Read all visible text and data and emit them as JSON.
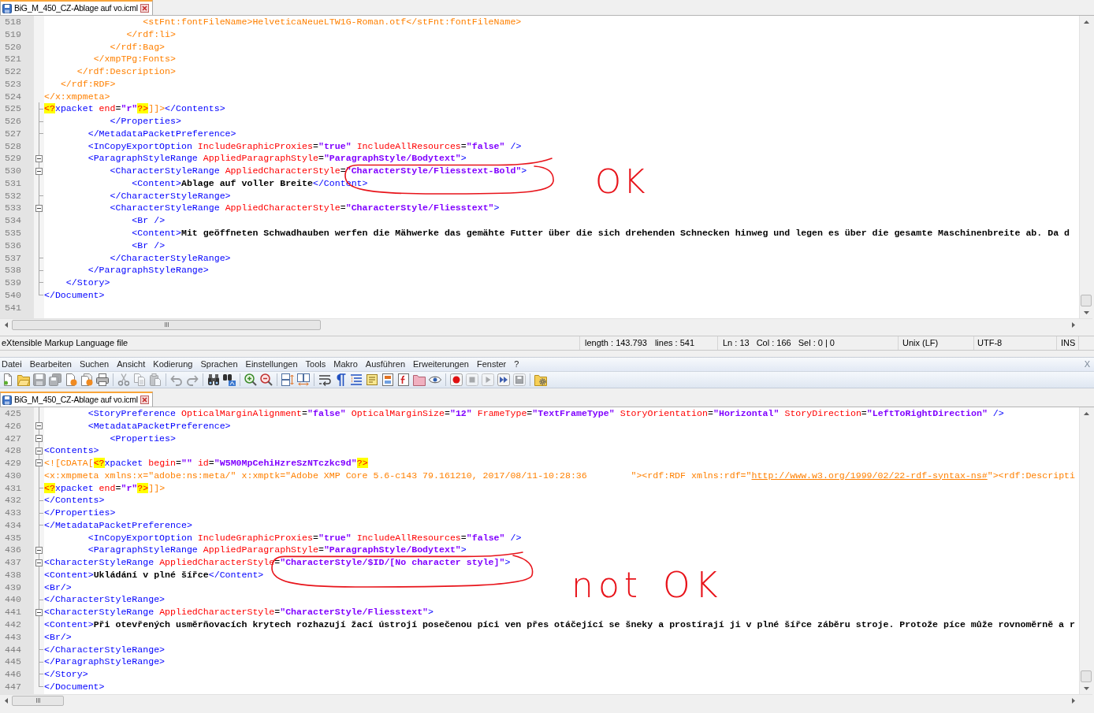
{
  "top_window": {
    "tabs": [
      {
        "label": "BiG_M_450_CZ-Ablage auf vo.icml",
        "selected": true
      }
    ],
    "editor": {
      "starts_in_cdata": true,
      "lines": [
        {
          "number": "518",
          "kind": "plain",
          "text": "                  <stFnt:fontFileName>HelveticaNeueLTW1G-Roman.otf</stFnt:fontFileName>"
        },
        {
          "number": "519",
          "kind": "plain",
          "text": "               </rdf:li>"
        },
        {
          "number": "520",
          "kind": "plain",
          "text": "            </rdf:Bag>"
        },
        {
          "number": "521",
          "kind": "plain",
          "text": "         </xmpTPg:Fonts>"
        },
        {
          "number": "522",
          "kind": "plain",
          "text": "      </rdf:Description>"
        },
        {
          "number": "523",
          "kind": "plain",
          "text": "   </rdf:RDF>"
        },
        {
          "number": "524",
          "kind": "plain",
          "text": "</x:xmpmeta>"
        },
        {
          "number": "525",
          "kind": "fold_end",
          "text": "<?xpacket end=\"r\"?>]]></Contents>"
        },
        {
          "number": "526",
          "kind": "fold_end",
          "text": "            </Properties>"
        },
        {
          "number": "527",
          "kind": "fold_end",
          "text": "        </MetadataPacketPreference>"
        },
        {
          "number": "528",
          "kind": "fold_body",
          "text": "        <InCopyExportOption IncludeGraphicProxies=\"true\" IncludeAllResources=\"false\" />"
        },
        {
          "number": "529",
          "kind": "fold_open",
          "text": "        <ParagraphStyleRange AppliedParagraphStyle=\"ParagraphStyle/Bodytext\">"
        },
        {
          "number": "530",
          "kind": "fold_open",
          "text": "            <CharacterStyleRange AppliedCharacterStyle=\"CharacterStyle/Fliesstext-Bold\">"
        },
        {
          "number": "531",
          "kind": "fold_body",
          "text": "                <Content>Ablage auf voller Breite</Content>"
        },
        {
          "number": "532",
          "kind": "fold_end",
          "text": "            </CharacterStyleRange>"
        },
        {
          "number": "533",
          "kind": "fold_open",
          "text": "            <CharacterStyleRange AppliedCharacterStyle=\"CharacterStyle/Fliesstext\">"
        },
        {
          "number": "534",
          "kind": "fold_body",
          "text": "                <Br />"
        },
        {
          "number": "535",
          "kind": "fold_body",
          "text": "                <Content>Mit geöffneten Schwadhauben werfen die Mähwerke das gemähte Futter über die sich drehenden Schnecken hinweg und legen es über die gesamte Maschinenbreite ab. Da d"
        },
        {
          "number": "536",
          "kind": "fold_body",
          "text": "                <Br />"
        },
        {
          "number": "537",
          "kind": "fold_end",
          "text": "            </CharacterStyleRange>"
        },
        {
          "number": "538",
          "kind": "fold_end",
          "text": "        </ParagraphStyleRange>"
        },
        {
          "number": "539",
          "kind": "fold_end",
          "text": "    </Story>"
        },
        {
          "number": "540",
          "kind": "fold_last",
          "text": "</Document>"
        },
        {
          "number": "541",
          "kind": "plain"
        }
      ],
      "annotation": {
        "text": "OK"
      }
    },
    "status_bar": {
      "file_type": "eXtensible Markup Language file",
      "length": "length : 143.793",
      "lines": "lines : 541",
      "position": "Ln : 13",
      "column": "Col : 166",
      "selection": "Sel : 0 | 0",
      "eol": "Unix (LF)",
      "encoding": "UTF-8",
      "mode": "INS"
    }
  },
  "bottom_window": {
    "menu": [
      "Datei",
      "Bearbeiten",
      "Suchen",
      "Ansicht",
      "Kodierung",
      "Sprachen",
      "Einstellungen",
      "Tools",
      "Makro",
      "Ausführen",
      "Erweiterungen",
      "Fenster",
      "?"
    ],
    "menu_close": "X",
    "toolbar": [
      {
        "kind": "new",
        "disabled": false
      },
      {
        "kind": "open",
        "disabled": false
      },
      {
        "kind": "save",
        "disabled": true
      },
      {
        "kind": "save_all",
        "disabled": true
      },
      {
        "kind": "close",
        "disabled": false
      },
      {
        "kind": "close_all",
        "disabled": false
      },
      {
        "kind": "print",
        "disabled": false
      },
      {
        "kind": "separator"
      },
      {
        "kind": "cut",
        "disabled": true
      },
      {
        "kind": "copy",
        "disabled": true
      },
      {
        "kind": "paste",
        "disabled": true
      },
      {
        "kind": "separator"
      },
      {
        "kind": "undo",
        "disabled": true
      },
      {
        "kind": "redo",
        "disabled": true
      },
      {
        "kind": "separator"
      },
      {
        "kind": "find",
        "disabled": false
      },
      {
        "kind": "replace",
        "disabled": false
      },
      {
        "kind": "separator"
      },
      {
        "kind": "zoom_in",
        "disabled": false
      },
      {
        "kind": "zoom_out",
        "disabled": false
      },
      {
        "kind": "separator"
      },
      {
        "kind": "sync_v",
        "disabled": false
      },
      {
        "kind": "sync_h",
        "disabled": false
      },
      {
        "kind": "separator"
      },
      {
        "kind": "wrap",
        "disabled": false
      },
      {
        "kind": "all_chars",
        "disabled": false
      },
      {
        "kind": "indent_guide",
        "disabled": false
      },
      {
        "kind": "udl",
        "disabled": false
      },
      {
        "kind": "doc_map",
        "disabled": false
      },
      {
        "kind": "func_list",
        "disabled": false
      },
      {
        "kind": "folder",
        "disabled": false
      },
      {
        "kind": "monitor",
        "disabled": false
      },
      {
        "kind": "separator"
      },
      {
        "kind": "record",
        "disabled": false
      },
      {
        "kind": "stop",
        "disabled": true
      },
      {
        "kind": "play",
        "disabled": true
      },
      {
        "kind": "play_multi",
        "disabled": false
      },
      {
        "kind": "save_macro",
        "disabled": true
      },
      {
        "kind": "separator"
      },
      {
        "kind": "plugin",
        "disabled": false
      }
    ],
    "tabs": [
      {
        "label": "BiG_M_450_CZ-Ablage auf vo.icml",
        "selected": true
      }
    ],
    "editor": {
      "starts_in_cdata": false,
      "lines": [
        {
          "number": "425",
          "kind": "fold_body",
          "text": "        <StoryPreference OpticalMarginAlignment=\"false\" OpticalMarginSize=\"12\" FrameType=\"TextFrameType\" StoryOrientation=\"Horizontal\" StoryDirection=\"LeftToRightDirection\" />"
        },
        {
          "number": "426",
          "kind": "fold_open",
          "text": "        <MetadataPacketPreference>"
        },
        {
          "number": "427",
          "kind": "fold_open",
          "text": "            <Properties>"
        },
        {
          "number": "428",
          "kind": "fold_open",
          "text": "<Contents>"
        },
        {
          "number": "429",
          "kind": "fold_open",
          "text": "<![CDATA[<?xpacket begin=\"\" id=\"W5M0MpCehiHzreSzNTczkc9d\"?>"
        },
        {
          "number": "430",
          "kind": "fold_body",
          "text": "<x:xmpmeta xmlns:x=\"adobe:ns:meta/\" x:xmptk=\"Adobe XMP Core 5.6-c143 79.161210, 2017/08/11-10:28:36        \"><rdf:RDF xmlns:rdf=\"http://www.w3.org/1999/02/22-rdf-syntax-ns#\"><rdf:Descripti"
        },
        {
          "number": "431",
          "kind": "fold_end",
          "text": "<?xpacket end=\"r\"?>]]>"
        },
        {
          "number": "432",
          "kind": "fold_end",
          "text": "</Contents>"
        },
        {
          "number": "433",
          "kind": "fold_end",
          "text": "</Properties>"
        },
        {
          "number": "434",
          "kind": "fold_end",
          "text": "</MetadataPacketPreference>"
        },
        {
          "number": "435",
          "kind": "fold_body",
          "text": "        <InCopyExportOption IncludeGraphicProxies=\"true\" IncludeAllResources=\"false\" />"
        },
        {
          "number": "436",
          "kind": "fold_open",
          "text": "        <ParagraphStyleRange AppliedParagraphStyle=\"ParagraphStyle/Bodytext\">"
        },
        {
          "number": "437",
          "kind": "fold_open",
          "text": "<CharacterStyleRange AppliedCharacterStyle=\"CharacterStyle/$ID/[No character style]\">"
        },
        {
          "number": "438",
          "kind": "fold_body",
          "text": "<Content>Ukládání v plné šířce</Content>"
        },
        {
          "number": "439",
          "kind": "fold_body",
          "text": "<Br/>"
        },
        {
          "number": "440",
          "kind": "fold_end",
          "text": "</CharacterStyleRange>"
        },
        {
          "number": "441",
          "kind": "fold_open",
          "text": "<CharacterStyleRange AppliedCharacterStyle=\"CharacterStyle/Fliesstext\">"
        },
        {
          "number": "442",
          "kind": "fold_body",
          "text": "<Content>Při otevřených usměrňovacích krytech rozhazují žací ústrojí posečenou píci ven přes otáčející se šneky a prostírají ji v plné šířce záběru stroje. Protože píce může rovnoměrně a r"
        },
        {
          "number": "443",
          "kind": "fold_body",
          "text": "<Br/>"
        },
        {
          "number": "444",
          "kind": "fold_end",
          "text": "</CharacterStyleRange>"
        },
        {
          "number": "445",
          "kind": "fold_end",
          "text": "</ParagraphStyleRange>"
        },
        {
          "number": "446",
          "kind": "fold_end",
          "text": "</Story>"
        },
        {
          "number": "447",
          "kind": "fold_last",
          "text": "</Document>"
        }
      ],
      "annotation": {
        "text": "not OK"
      }
    }
  }
}
